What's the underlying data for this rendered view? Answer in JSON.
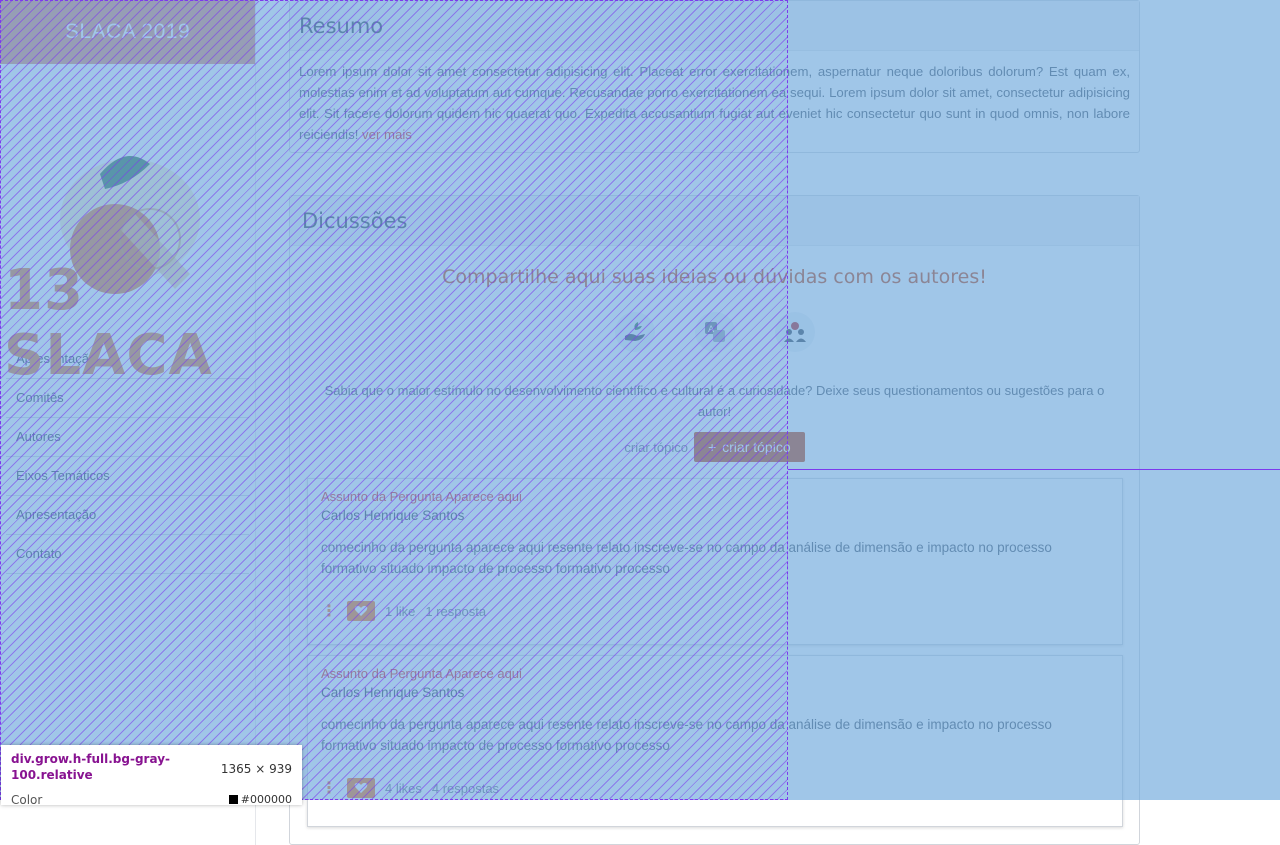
{
  "sidebar": {
    "brand": "SLACA 2019",
    "logo_text": "13 SLACA",
    "items": [
      {
        "label": "Apresentação"
      },
      {
        "label": "Comitês"
      },
      {
        "label": "Autores"
      },
      {
        "label": "Eixos Temáticos"
      },
      {
        "label": "Apresentação"
      },
      {
        "label": "Contato"
      }
    ]
  },
  "resumo": {
    "title": "Resumo",
    "text": "Lorem ipsum dolor sit amet consectetur adipisicing elit. Placeat error exercitationem, aspernatur neque doloribus dolorum? Est quam ex, molestias enim et ad voluptatum aut cumque. Recusandae porro exercitationem ea sequi. Lorem ipsum dolor sit amet, consectetur adipisicing elit. Sit facere dolorum quidem hic quaerat quo. Expedita accusantium fugiat aut eveniet hic consectetur quo sunt in quod omnis, non labore reiciendis!",
    "more_link": "ver mais"
  },
  "discussoes": {
    "title": "Dicussões",
    "heading": "Compartilhe aqui suas ideias ou dúvidas com os autores!",
    "icons": [
      "hand-plant-icon",
      "translate-icon",
      "people-icon"
    ],
    "description": "Sabia que o maior estímulo no desenvolvimento científico e cultural é a curiosidade? Deixe seus questionamentos ou sugestões para o autor!",
    "create_label": "criar tópico",
    "create_button": "criar tópico",
    "topics": [
      {
        "title": "Assunto da Pergunta Aparece aqui",
        "author": "Carlos Henrique Santos",
        "body": "comecinho da pergunta aparece aqui resente relato inscreve-se no campo da análise de dimensão e impacto no processo formativo situado impacto de processo formativo processo",
        "likes": "1 like",
        "replies": "1 resposta"
      },
      {
        "title": "Assunto da Pergunta Aparece aqui",
        "author": "Carlos Henrique Santos",
        "body": "comecinho da pergunta aparece aqui resente relato inscreve-se no campo da análise de dimensão e impacto no processo formativo situado impacto de processo formativo processo",
        "likes": "4 likes",
        "replies": "4 respostas"
      }
    ]
  },
  "devtools": {
    "element_name": "div.grow.h-full.bg-gray-100.relative",
    "element_size": "1365 × 939",
    "color_label": "Color",
    "color_value": "#000000"
  },
  "colors": {
    "accent": "#c2410c",
    "orange": "#f97316",
    "overlay": "#6fa8dc",
    "hatch": "#7c3aed"
  }
}
